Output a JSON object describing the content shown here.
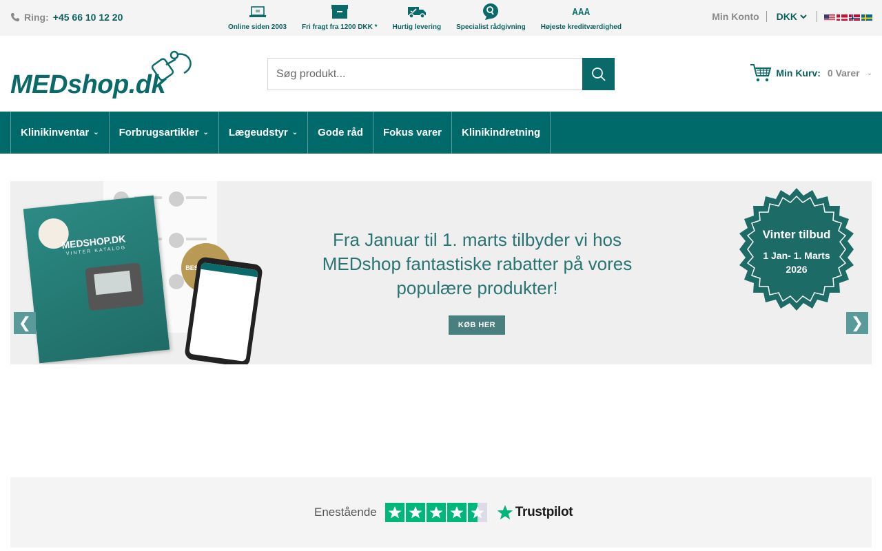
{
  "topbar": {
    "phone_label": "Ring:",
    "phone_number": "+45 66 10 12 20",
    "usps": [
      {
        "icon": "laptop-icon",
        "label": "Online siden 2003"
      },
      {
        "icon": "box-icon",
        "label": "Fri fragt fra 1200 DKK *"
      },
      {
        "icon": "truck-icon",
        "label": "Hurtig levering"
      },
      {
        "icon": "advice-icon",
        "label": "Specialist rådgivning"
      },
      {
        "icon": "rating-icon",
        "label": "Højeste kreditværdighed",
        "icon_text": "AAA"
      }
    ],
    "account_label": "Min Konto",
    "currency_label": "DKK",
    "flags": [
      "us-flag-icon",
      "dk-flag-icon",
      "no-flag-icon",
      "se-flag-icon"
    ]
  },
  "header": {
    "logo_text": "MEDshop.dk",
    "search_placeholder": "Søg produkt...",
    "cart_label": "Min Kurv:",
    "cart_count": "0 Varer"
  },
  "nav": {
    "items": [
      {
        "label": "Klinikinventar",
        "has_dropdown": true
      },
      {
        "label": "Forbrugsartikler",
        "has_dropdown": true
      },
      {
        "label": "Lægeudstyr",
        "has_dropdown": true
      },
      {
        "label": "Gode råd",
        "has_dropdown": false
      },
      {
        "label": "Fokus varer",
        "has_dropdown": false
      },
      {
        "label": "Klinikindretning",
        "has_dropdown": false
      }
    ]
  },
  "banner": {
    "line1": "Fra Januar til 1. marts tilbyder vi hos",
    "line2": "MEDshop fantastiske rabatter på vores",
    "line3": "populære produkter!",
    "button_label": "KØB HER",
    "badge_title": "Vinter tilbud",
    "badge_line1": "1 Jan- 1. Marts",
    "badge_line2": "2026",
    "catalog_title": "MEDSHOP.DK",
    "catalog_sub": "VINTER KATALOG",
    "bestseller": "BESTSELLER",
    "prev_arrow": "❮",
    "next_arrow": "❯"
  },
  "trust": {
    "label": "Enestående",
    "brand": "Trustpilot",
    "rating": 4.5
  },
  "colors": {
    "primary": "#006a6a",
    "accent_text": "#0a5f5f",
    "trustpilot_green": "#00b67a"
  }
}
